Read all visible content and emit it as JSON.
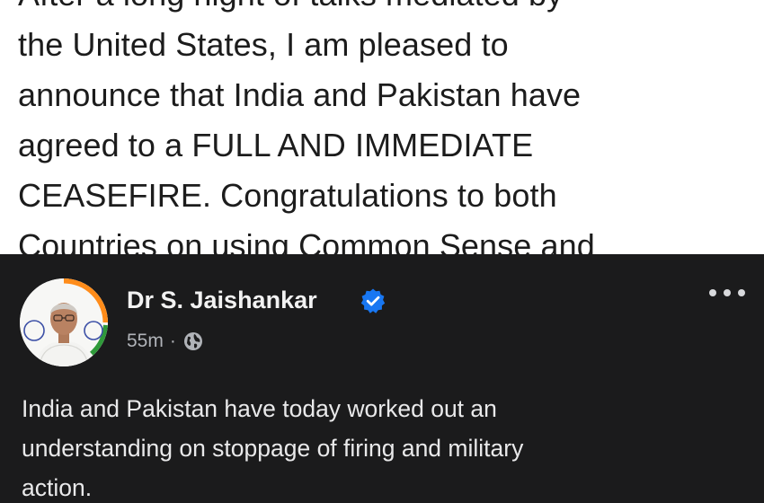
{
  "top_post": {
    "lines": [
      "After a long night of talks mediated by",
      "the United States, I am pleased to",
      "announce that India and Pakistan have",
      "agreed to a FULL AND IMMEDIATE",
      "CEASEFIRE. Congratulations to both",
      "Countries on using Common Sense and"
    ]
  },
  "bottom_post": {
    "author_name": "Dr S. Jaishankar",
    "verified": true,
    "timestamp": "55m",
    "separator": "·",
    "audience_icon": "globe-icon",
    "more_icon": "more-options-icon",
    "body_lines": [
      "India and Pakistan have today worked out an",
      "understanding on stoppage of firing and military",
      "action."
    ],
    "colors": {
      "background": "#1b1b1c",
      "name_text": "#f2f2f2",
      "meta_text": "#b0b3b8",
      "verified_badge": "#1877f2",
      "avatar_ring": "#ff8c1a"
    }
  }
}
